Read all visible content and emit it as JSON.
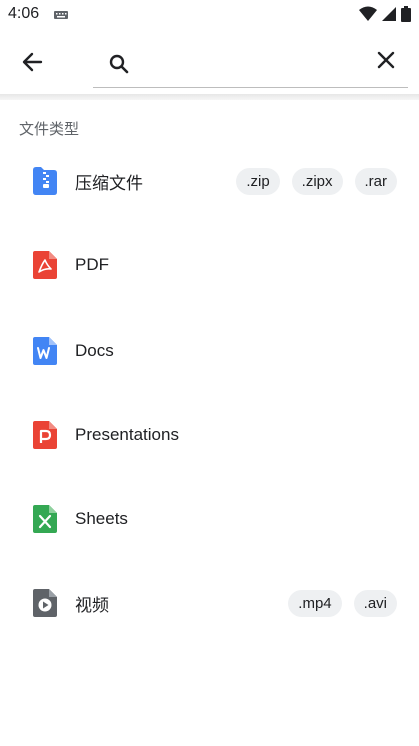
{
  "status_bar": {
    "time": "4:06"
  },
  "search": {
    "placeholder": ""
  },
  "section": {
    "title": "文件类型"
  },
  "types": [
    {
      "label": "压缩文件",
      "icon": "zip-icon",
      "chips": [
        ".zip",
        ".zipx",
        ".rar"
      ]
    },
    {
      "label": "PDF",
      "icon": "pdf-icon",
      "chips": []
    },
    {
      "label": "Docs",
      "icon": "docs-icon",
      "chips": []
    },
    {
      "label": "Presentations",
      "icon": "slides-icon",
      "chips": []
    },
    {
      "label": "Sheets",
      "icon": "sheets-icon",
      "chips": []
    },
    {
      "label": "视频",
      "icon": "video-icon",
      "chips": [
        ".mp4",
        ".avi"
      ]
    }
  ],
  "colors": {
    "zip": "#4285f4",
    "pdf": "#ea4335",
    "docs": "#4285f4",
    "slides": "#ea4335",
    "sheets": "#34a853",
    "video": "#5f6368"
  }
}
